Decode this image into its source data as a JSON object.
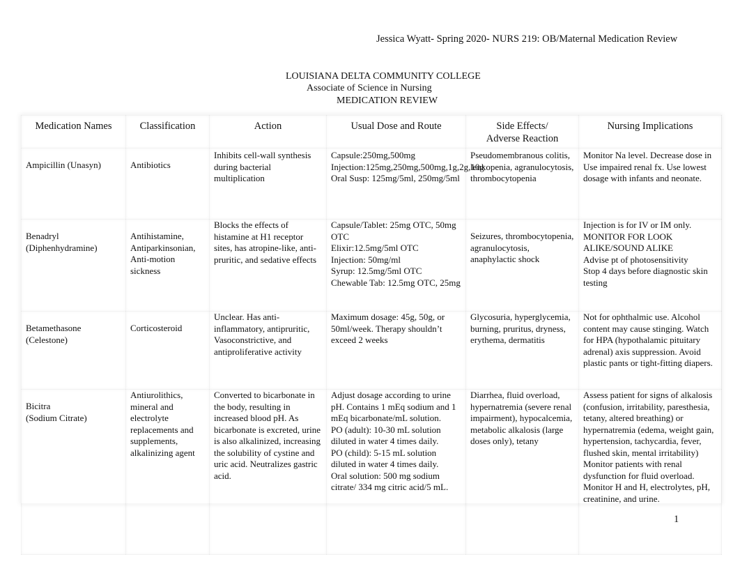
{
  "document": {
    "header": "Jessica Wyatt- Spring 2020- NURS 219: OB/Maternal Medication Review",
    "institution": "LOUISIANA DELTA COMMUNITY COLLEGE",
    "program": "Associate of Science in Nursing",
    "title": "MEDICATION REVIEW",
    "page_number": "1"
  },
  "table": {
    "columns": [
      "Medication Names",
      "Classification",
      "Action",
      "Usual Dose and Route",
      "Side Effects/\nAdverse Reaction",
      "Nursing Implications"
    ],
    "rows": [
      {
        "name": "Ampicillin (Unasyn)",
        "classification": "Antibiotics",
        "action": "Inhibits cell-wall synthesis during bacterial multiplication",
        "dose_route": "Capsule:250mg,500mg\nInjection:125mg,250mg,500mg,1g,2g,10g\nOral Susp: 125mg/5ml, 250mg/5ml",
        "side_effects": "Pseudomembranous colitis, leukopenia, agranulocytosis, thrombocytopenia",
        "nursing_implications": "Monitor Na level. Decrease dose in Use impaired renal fx. Use lowest dosage with infants and neonate."
      },
      {
        "name": "Benadryl\n(Diphenhydramine)",
        "classification": "Antihistamine, Antiparkinsonian, Anti-motion sickness",
        "action": "Blocks the effects of histamine at H1 receptor sites, has atropine-like, anti-pruritic, and sedative effects",
        "dose_route": "Capsule/Tablet:  25mg OTC, 50mg OTC\nElixir:12.5mg/5ml OTC\nInjection: 50mg/ml\nSyrup: 12.5mg/5ml OTC\nChewable Tab: 12.5mg OTC, 25mg",
        "side_effects": "Seizures, thrombocytopenia, agranulocytosis, anaphylactic shock",
        "nursing_implications": "Injection is for IV or IM only.\nMONITOR FOR LOOK ALIKE/SOUND ALIKE\nAdvise pt of photosensitivity\nStop 4 days before diagnostic skin testing"
      },
      {
        "name": "Betamethasone\n(Celestone)",
        "classification": "Corticosteroid",
        "action": "Unclear. Has anti-inflammatory, antipruritic, Vasoconstrictive, and antiproliferative activity",
        "dose_route": "Maximum dosage: 45g, 50g, or 50ml/week. Therapy shouldn’t exceed 2 weeks",
        "side_effects": "Glycosuria, hyperglycemia, burning, pruritus, dryness, erythema, dermatitis",
        "nursing_implications": "Not for ophthalmic use. Alcohol content may cause stinging. Watch for HPA (hypothalamic pituitary adrenal) axis suppression. Avoid plastic pants or tight-fitting diapers."
      },
      {
        "name": "Bicitra\n(Sodium Citrate)",
        "classification": "Antiurolithics, mineral and electrolyte replacements and supplements, alkalinizing agent",
        "action": "Converted to bicarbonate in the body, resulting in increased blood pH. As bicarbonate is excreted, urine is also alkalinized, increasing the solubility of cystine and uric acid. Neutralizes gastric acid.",
        "dose_route": "Adjust dosage according to urine pH. Contains 1 mEq sodium and 1 mEq bicarbonate/mL solution.\nPO (adult): 10-30 mL solution diluted in water 4 times daily.\nPO (child): 5-15 mL solution diluted in water 4 times daily.\nOral solution: 500 mg sodium citrate/ 334 mg citric acid/5 mL.",
        "side_effects": "Diarrhea, fluid overload, hypernatremia (severe renal impairment), hypocalcemia, metabolic alkalosis (large doses only), tetany",
        "nursing_implications": "Assess patient for signs of alkalosis (confusion, irritability, paresthesia, tetany, altered breathing) or hypernatremia (edema, weight gain, hypertension, tachycardia, fever, flushed skin, mental irritability)\nMonitor patients with renal dysfunction for fluid overload.\nMonitor H and H, electrolytes, pH, creatinine, and urine."
      }
    ]
  }
}
